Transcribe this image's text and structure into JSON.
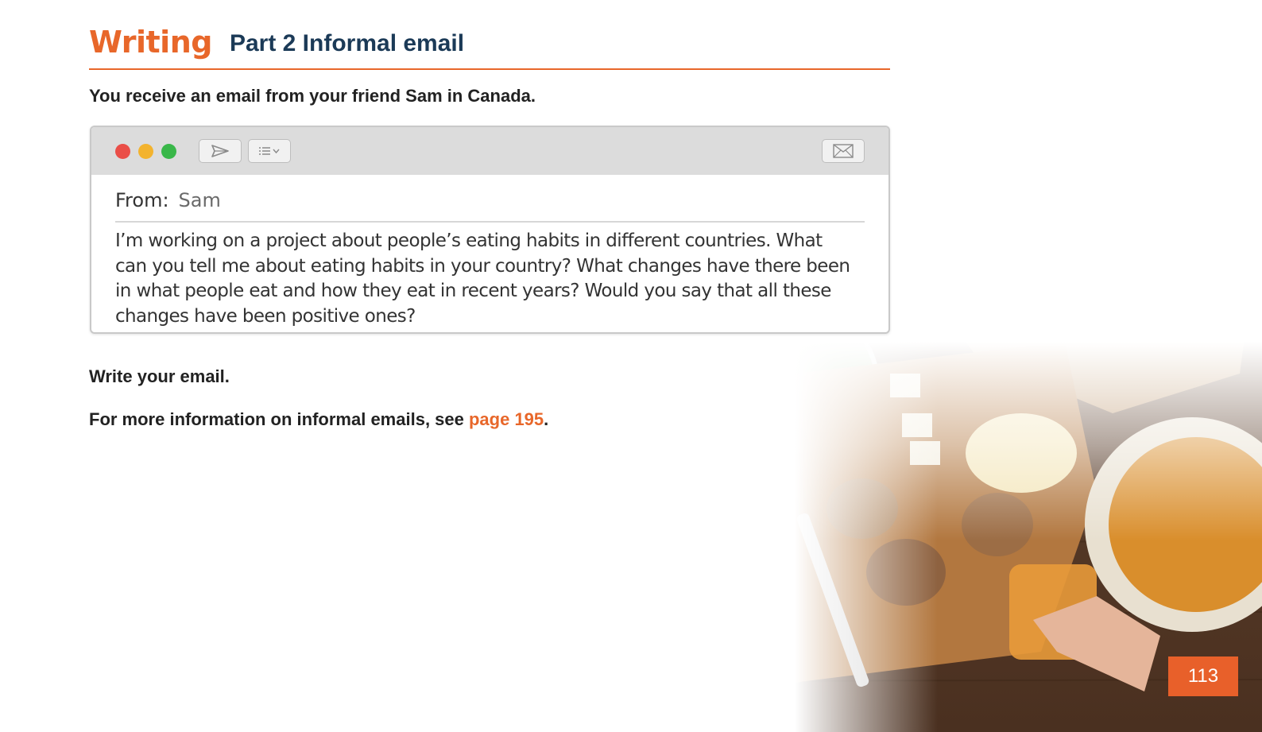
{
  "header": {
    "section": "Writing",
    "part": "Part 2 Informal email"
  },
  "intro": "You receive an email from your friend Sam in Canada.",
  "email": {
    "toolbar": {
      "send_icon": "send-icon",
      "list_icon": "list-menu-icon",
      "mail_icon": "envelope-icon"
    },
    "from_label": "From:",
    "from_name": "Sam",
    "lines": [
      "I’m working on a project about people’s eating habits in different countries. What",
      "can you tell me about eating habits in your country? What changes have there been",
      "in what people eat and how they eat in recent years? Would you say that all these",
      "changes have been positive ones?"
    ]
  },
  "instruction": {
    "prefix": "Write your ",
    "bold": "email",
    "suffix": "."
  },
  "info": {
    "text": "For more information on informal emails, see ",
    "link": "page 195",
    "suffix": "."
  },
  "page_number": "113",
  "colors": {
    "accent": "#e8672a",
    "title": "#1b3a57"
  }
}
